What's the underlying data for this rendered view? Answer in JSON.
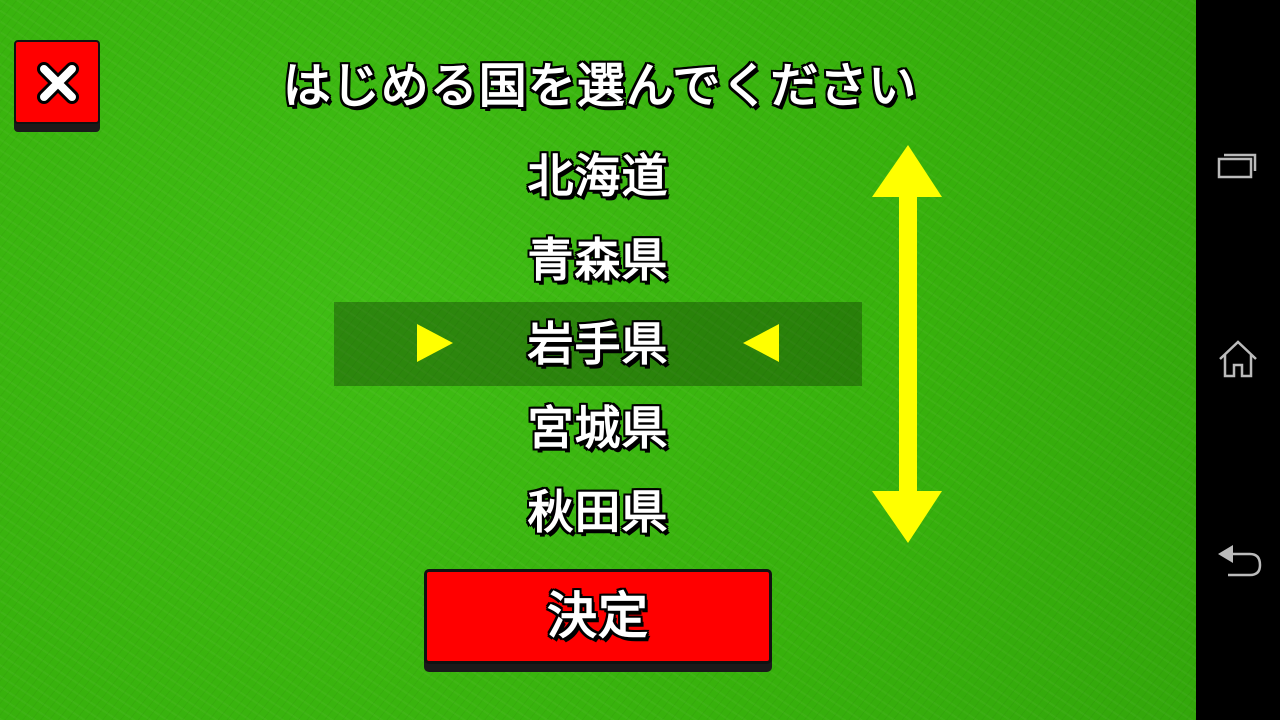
{
  "title": "はじめる国を選んでください",
  "close_button": {
    "icon": "close-icon"
  },
  "prefectures": {
    "items": [
      "北海道",
      "青森県",
      "岩手県",
      "宮城県",
      "秋田県"
    ],
    "selected": "岩手県"
  },
  "scroll_indicator": {
    "icon": "up-down-arrow-icon",
    "color": "#ffff00"
  },
  "confirm_button": {
    "label": "決定"
  },
  "colors": {
    "background": "#37b10c",
    "button": "#ff0000",
    "accent": "#ffff00",
    "selection": "#276f0e"
  },
  "nav_bar": {
    "icons": [
      "recent-apps-icon",
      "home-icon",
      "back-icon"
    ]
  }
}
